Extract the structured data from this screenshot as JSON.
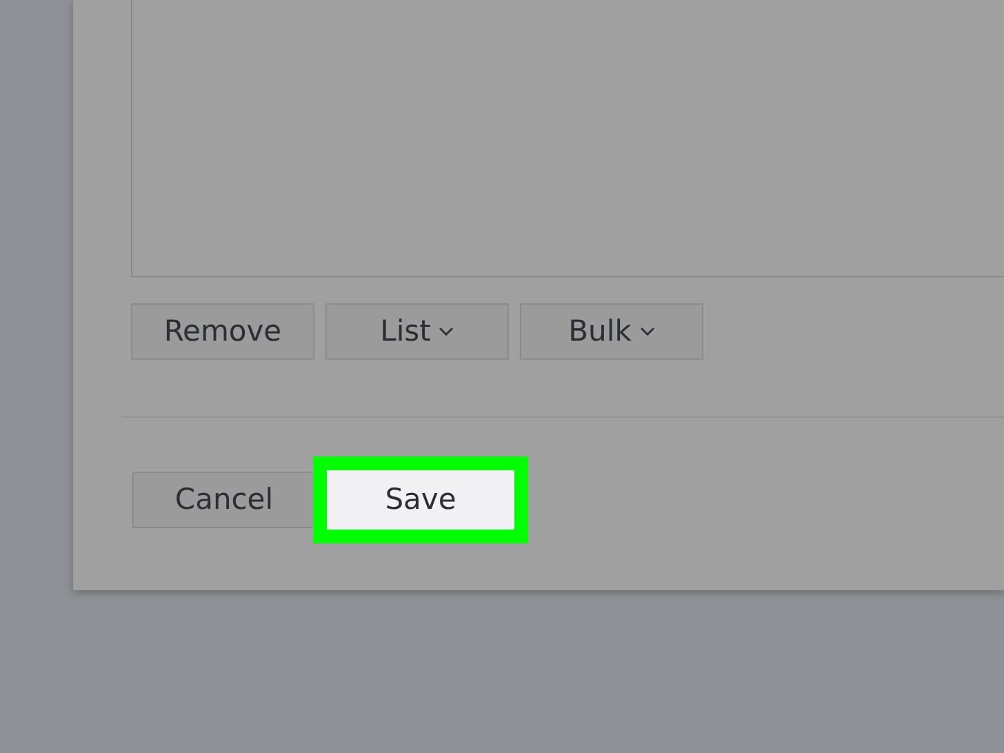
{
  "text_area": {
    "kind": "empty"
  },
  "toolbar_buttons": [
    {
      "label": "Remove",
      "kind": "plain"
    },
    {
      "label": "List",
      "kind": "dropdown"
    },
    {
      "label": "Bulk",
      "kind": "dropdown"
    }
  ],
  "footer_buttons": [
    {
      "label": "Cancel",
      "highlighted": false
    },
    {
      "label": "Save",
      "highlighted": true
    }
  ]
}
